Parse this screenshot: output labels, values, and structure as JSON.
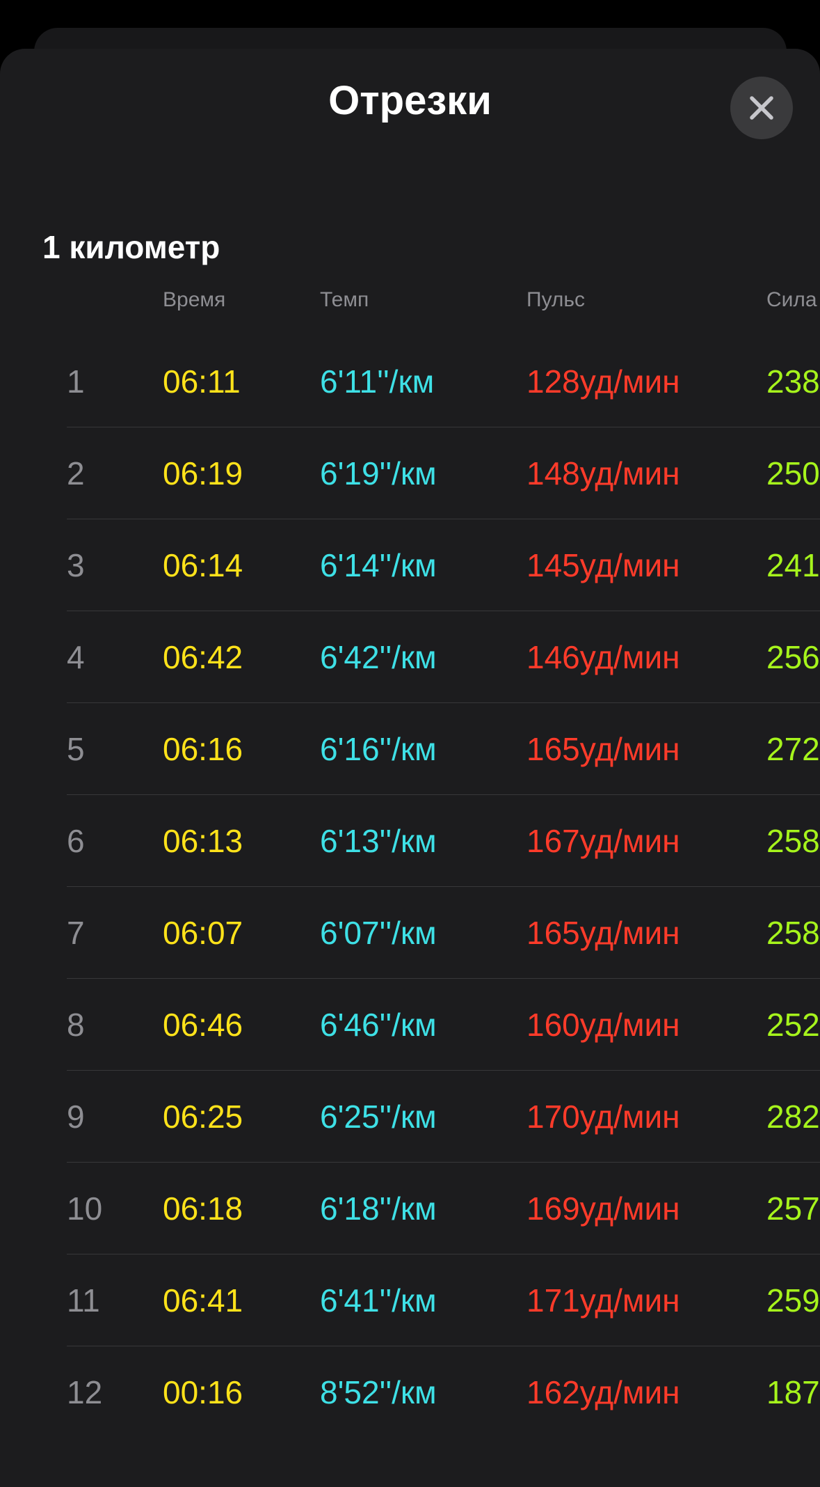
{
  "sheet": {
    "title": "Отрезки",
    "close_icon": "close-icon"
  },
  "section": {
    "title": "1 километр"
  },
  "columns": {
    "time": "Время",
    "pace": "Темп",
    "heart_rate": "Пульс",
    "power": "Сила"
  },
  "colors": {
    "time": "#ffe21a",
    "pace": "#3ee0e6",
    "heart_rate": "#ff3b2a",
    "power": "#a6f41c",
    "index": "#8e8e93"
  },
  "splits": [
    {
      "num": "1",
      "time": "06:11",
      "pace": "6'11''/км",
      "hr": "128уд/мин",
      "power": "238"
    },
    {
      "num": "2",
      "time": "06:19",
      "pace": "6'19''/км",
      "hr": "148уд/мин",
      "power": "250"
    },
    {
      "num": "3",
      "time": "06:14",
      "pace": "6'14''/км",
      "hr": "145уд/мин",
      "power": "241"
    },
    {
      "num": "4",
      "time": "06:42",
      "pace": "6'42''/км",
      "hr": "146уд/мин",
      "power": "256"
    },
    {
      "num": "5",
      "time": "06:16",
      "pace": "6'16''/км",
      "hr": "165уд/мин",
      "power": "272"
    },
    {
      "num": "6",
      "time": "06:13",
      "pace": "6'13''/км",
      "hr": "167уд/мин",
      "power": "258"
    },
    {
      "num": "7",
      "time": "06:07",
      "pace": "6'07''/км",
      "hr": "165уд/мин",
      "power": "258"
    },
    {
      "num": "8",
      "time": "06:46",
      "pace": "6'46''/км",
      "hr": "160уд/мин",
      "power": "252"
    },
    {
      "num": "9",
      "time": "06:25",
      "pace": "6'25''/км",
      "hr": "170уд/мин",
      "power": "282"
    },
    {
      "num": "10",
      "time": "06:18",
      "pace": "6'18''/км",
      "hr": "169уд/мин",
      "power": "257"
    },
    {
      "num": "11",
      "time": "06:41",
      "pace": "6'41''/км",
      "hr": "171уд/мин",
      "power": "259"
    },
    {
      "num": "12",
      "time": "00:16",
      "pace": "8'52''/км",
      "hr": "162уд/мин",
      "power": "187"
    }
  ]
}
